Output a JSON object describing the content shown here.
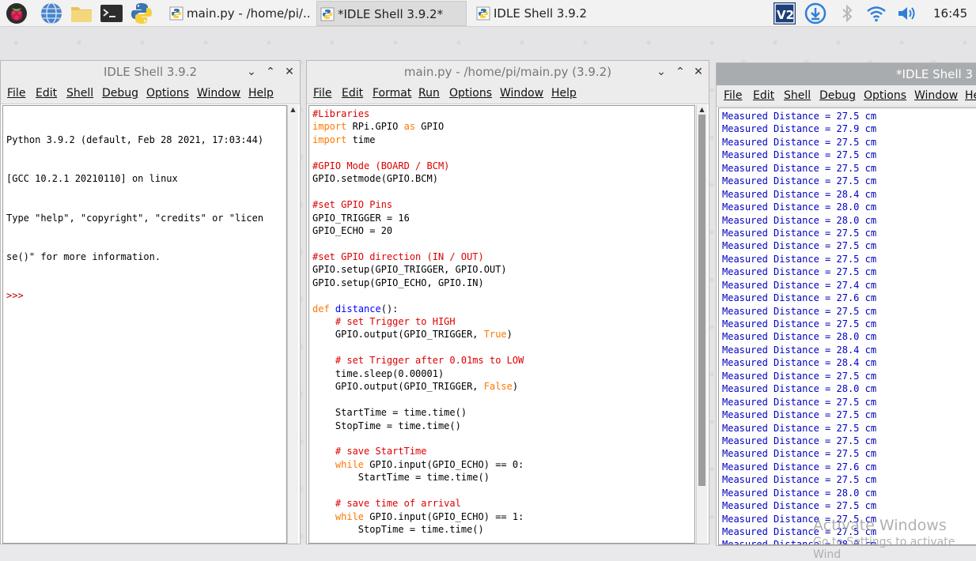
{
  "taskbar": {
    "tasks": [
      {
        "label": "main.py - /home/pi/..."
      },
      {
        "label": "*IDLE Shell 3.9.2*"
      },
      {
        "label": "IDLE Shell 3.9.2"
      }
    ],
    "clock": "16:45",
    "colors": {
      "accent": "#2f62a6"
    }
  },
  "shell_left": {
    "title": "IDLE Shell 3.9.2",
    "menu": [
      "File",
      "Edit",
      "Shell",
      "Debug",
      "Options",
      "Window",
      "Help"
    ],
    "lines": [
      "Python 3.9.2 (default, Feb 28 2021, 17:03:44)",
      "[GCC 10.2.1 20210110] on linux",
      "Type \"help\", \"copyright\", \"credits\" or \"licen",
      "se()\" for more information."
    ],
    "prompt": ">>>"
  },
  "editor": {
    "title": "main.py - /home/pi/main.py (3.9.2)",
    "menu": [
      "File",
      "Edit",
      "Format",
      "Run",
      "Options",
      "Window",
      "Help"
    ],
    "code": [
      [
        [
          "cm",
          "#Libraries"
        ]
      ],
      [
        [
          "kw",
          "import"
        ],
        [
          "",
          " RPi.GPIO "
        ],
        [
          "kw",
          "as"
        ],
        [
          "",
          " GPIO"
        ]
      ],
      [
        [
          "kw",
          "import"
        ],
        [
          "",
          " time"
        ]
      ],
      [
        [
          "",
          ""
        ]
      ],
      [
        [
          "cm",
          "#GPIO Mode (BOARD / BCM)"
        ]
      ],
      [
        [
          "",
          "GPIO.setmode(GPIO.BCM)"
        ]
      ],
      [
        [
          "",
          ""
        ]
      ],
      [
        [
          "cm",
          "#set GPIO Pins"
        ]
      ],
      [
        [
          "",
          "GPIO_TRIGGER = 16"
        ]
      ],
      [
        [
          "",
          "GPIO_ECHO = 20"
        ]
      ],
      [
        [
          "",
          ""
        ]
      ],
      [
        [
          "cm",
          "#set GPIO direction (IN / OUT)"
        ]
      ],
      [
        [
          "",
          "GPIO.setup(GPIO_TRIGGER, GPIO.OUT)"
        ]
      ],
      [
        [
          "",
          "GPIO.setup(GPIO_ECHO, GPIO.IN)"
        ]
      ],
      [
        [
          "",
          ""
        ]
      ],
      [
        [
          "kw",
          "def"
        ],
        [
          "",
          " "
        ],
        [
          "fn",
          "distance"
        ],
        [
          "",
          "():"
        ]
      ],
      [
        [
          "",
          "    "
        ],
        [
          "cm",
          "# set Trigger to HIGH"
        ]
      ],
      [
        [
          "",
          "    GPIO.output(GPIO_TRIGGER, "
        ],
        [
          "kw",
          "True"
        ],
        [
          "",
          ")"
        ]
      ],
      [
        [
          "",
          ""
        ]
      ],
      [
        [
          "",
          "    "
        ],
        [
          "cm",
          "# set Trigger after 0.01ms to LOW"
        ]
      ],
      [
        [
          "",
          "    time.sleep(0.00001)"
        ]
      ],
      [
        [
          "",
          "    GPIO.output(GPIO_TRIGGER, "
        ],
        [
          "kw",
          "False"
        ],
        [
          "",
          ")"
        ]
      ],
      [
        [
          "",
          ""
        ]
      ],
      [
        [
          "",
          "    StartTime = time.time()"
        ]
      ],
      [
        [
          "",
          "    StopTime = time.time()"
        ]
      ],
      [
        [
          "",
          ""
        ]
      ],
      [
        [
          "",
          "    "
        ],
        [
          "cm",
          "# save StartTime"
        ]
      ],
      [
        [
          "",
          "    "
        ],
        [
          "kw",
          "while"
        ],
        [
          "",
          " GPIO.input(GPIO_ECHO) == 0:"
        ]
      ],
      [
        [
          "",
          "        StartTime = time.time()"
        ]
      ],
      [
        [
          "",
          ""
        ]
      ],
      [
        [
          "",
          "    "
        ],
        [
          "cm",
          "# save time of arrival"
        ]
      ],
      [
        [
          "",
          "    "
        ],
        [
          "kw",
          "while"
        ],
        [
          "",
          " GPIO.input(GPIO_ECHO) == 1:"
        ]
      ],
      [
        [
          "",
          "        StopTime = time.time()"
        ]
      ]
    ]
  },
  "shell_right": {
    "title": "*IDLE Shell 3",
    "menu": [
      "File",
      "Edit",
      "Shell",
      "Debug",
      "Options",
      "Window",
      "He"
    ],
    "prefix": "Measured Distance = ",
    "unit": " cm",
    "values": [
      "27.5",
      "27.9",
      "27.5",
      "27.5",
      "27.5",
      "27.5",
      "28.4",
      "28.0",
      "28.0",
      "27.5",
      "27.5",
      "27.5",
      "27.5",
      "27.4",
      "27.6",
      "27.5",
      "27.5",
      "28.0",
      "28.4",
      "28.4",
      "27.5",
      "28.0",
      "27.5",
      "27.5",
      "27.5",
      "27.5",
      "27.5",
      "27.6",
      "27.5",
      "28.0",
      "27.5",
      "27.5",
      "27.5",
      "28.0"
    ]
  },
  "watermark": {
    "line1": "Activate Windows",
    "line2": "Go to Settings to activate Wind"
  }
}
